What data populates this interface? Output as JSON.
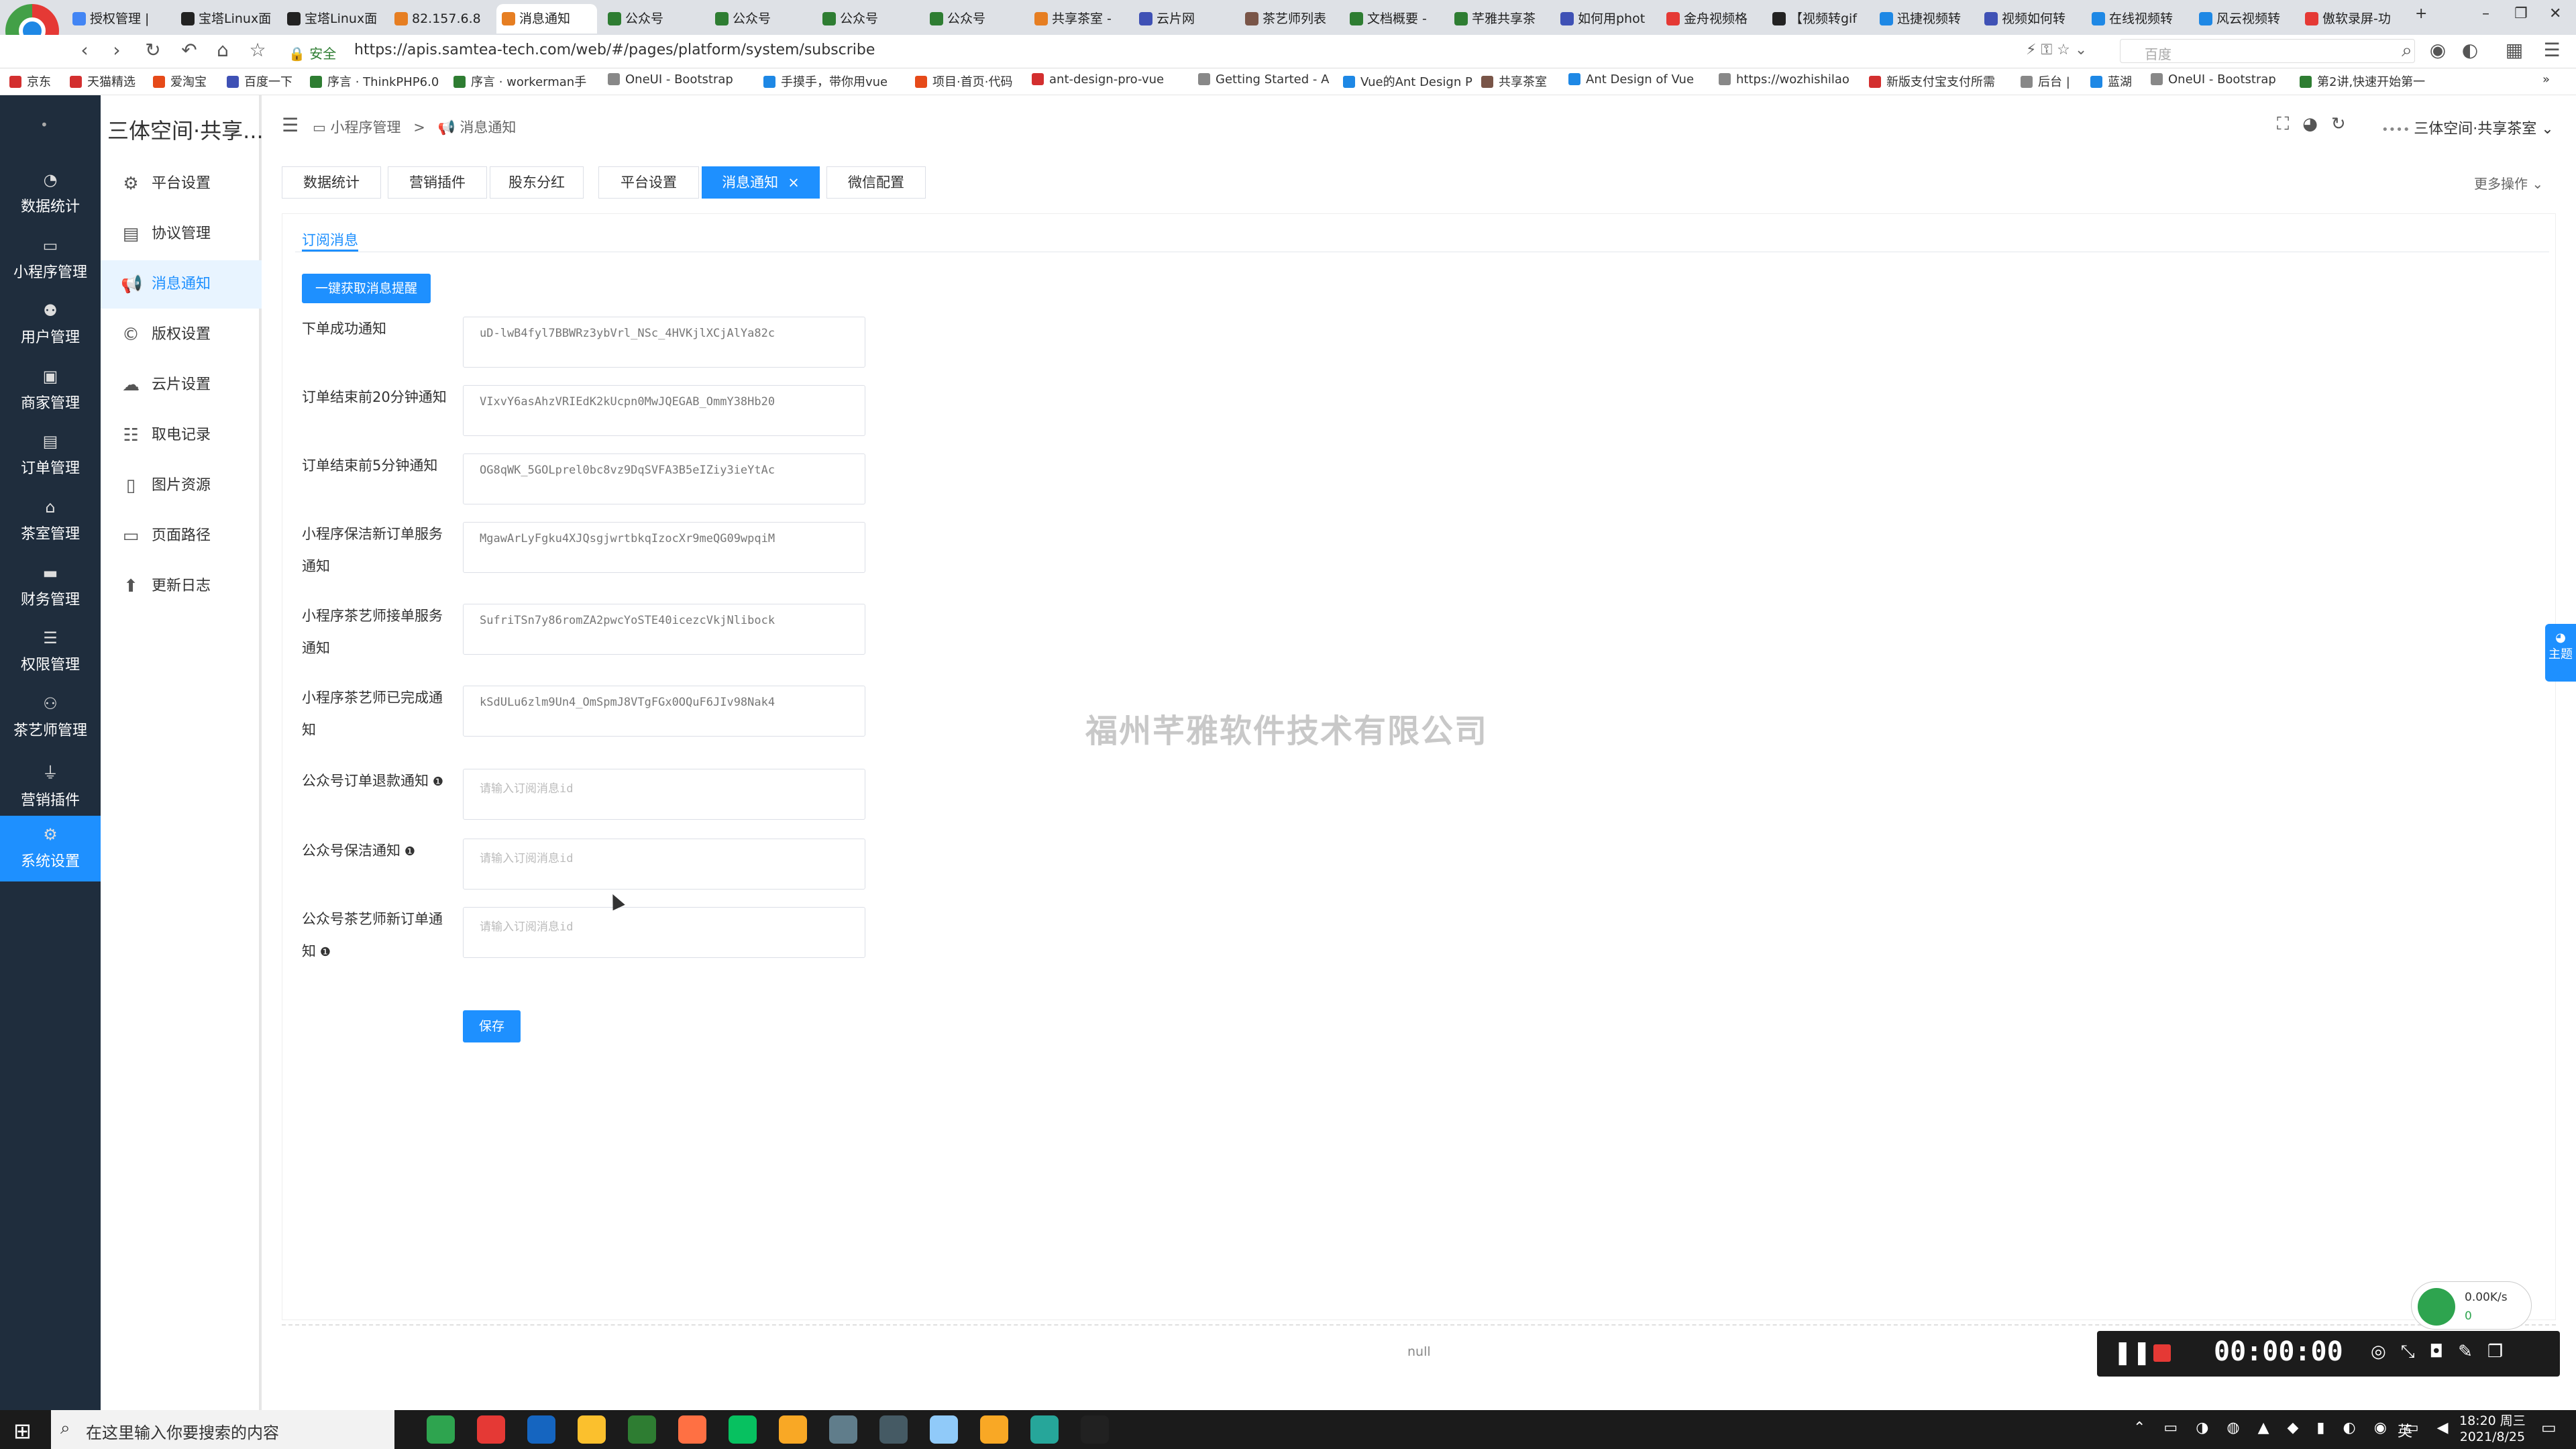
{
  "browser": {
    "tabs": [
      {
        "label": "授权管理 | ",
        "color": "#4285f4"
      },
      {
        "label": "宝塔Linux面",
        "color": "#222222"
      },
      {
        "label": "宝塔Linux面",
        "color": "#222222"
      },
      {
        "label": "82.157.6.8 ",
        "color": "#e67e22"
      },
      {
        "label": "消息通知",
        "color": "#e67e22"
      },
      {
        "label": "公众号",
        "color": "#2e7d32"
      },
      {
        "label": "公众号",
        "color": "#2e7d32"
      },
      {
        "label": "公众号",
        "color": "#2e7d32"
      },
      {
        "label": "公众号",
        "color": "#2e7d32"
      },
      {
        "label": "共享茶室 - ",
        "color": "#e67e22"
      },
      {
        "label": "云片网",
        "color": "#3f51b5"
      },
      {
        "label": "茶艺师列表",
        "color": "#795548"
      },
      {
        "label": "文档概要 - ",
        "color": "#2e7d32"
      },
      {
        "label": "芊雅共享茶",
        "color": "#2e7d32"
      },
      {
        "label": "如何用phot",
        "color": "#3f51b5"
      },
      {
        "label": "金舟视频格",
        "color": "#e53935"
      },
      {
        "label": "【视频转gif",
        "color": "#222222"
      },
      {
        "label": "迅捷视频转",
        "color": "#1e88e5"
      },
      {
        "label": "视频如何转",
        "color": "#3f51b5"
      },
      {
        "label": "在线视频转",
        "color": "#1e88e5"
      },
      {
        "label": "风云视频转",
        "color": "#1e88e5"
      },
      {
        "label": "傲软录屏-功",
        "color": "#e53935"
      }
    ],
    "secure_label": "安全",
    "url": "https://apis.samtea-tech.com/web/#/pages/platform/system/subscribe",
    "search_placeholder": "百度",
    "bookmarks": [
      "京东",
      "天猫精选",
      "爱淘宝",
      "百度一下",
      "序言 · ThinkPHP6.0",
      "序言 · workerman手",
      "OneUI - Bootstrap",
      "手摸手，带你用vue",
      "项目·首页·代码",
      "ant-design-pro-vue",
      "Getting Started - A",
      "Vue的Ant Design P",
      "共享茶室",
      "Ant Design of Vue",
      "https://wozhishilao",
      "新版支付宝支付所需",
      "后台 |",
      "蓝湖",
      "OneUI - Bootstrap",
      "第2讲,快速开始第一"
    ]
  },
  "app": {
    "brand": "三体空间·共享...",
    "sidebar": [
      {
        "label": "数据统计",
        "icon": "dashboard-icon",
        "glyph": "◔"
      },
      {
        "label": "小程序管理",
        "icon": "monitor-icon",
        "glyph": "▭"
      },
      {
        "label": "用户管理",
        "icon": "users-icon",
        "glyph": "⚉"
      },
      {
        "label": "商家管理",
        "icon": "store-icon",
        "glyph": "▣"
      },
      {
        "label": "订单管理",
        "icon": "clipboard-icon",
        "glyph": "▤"
      },
      {
        "label": "茶室管理",
        "icon": "home-icon",
        "glyph": "⌂"
      },
      {
        "label": "财务管理",
        "icon": "wallet-icon",
        "glyph": "▬"
      },
      {
        "label": "权限管理",
        "icon": "database-icon",
        "glyph": "☰"
      },
      {
        "label": "茶艺师管理",
        "icon": "user-icon",
        "glyph": "⚇"
      },
      {
        "label": "营销插件",
        "icon": "plug-icon",
        "glyph": "⏚"
      },
      {
        "label": "系统设置",
        "icon": "gear-icon",
        "glyph": "⚙"
      }
    ],
    "submenu": [
      {
        "label": "平台设置",
        "icon": "gear-icon",
        "glyph": "⚙"
      },
      {
        "label": "协议管理",
        "icon": "document-icon",
        "glyph": "▤"
      },
      {
        "label": "消息通知",
        "icon": "megaphone-icon",
        "glyph": "📢"
      },
      {
        "label": "版权设置",
        "icon": "copyright-icon",
        "glyph": "©"
      },
      {
        "label": "云片设置",
        "icon": "cloud-icon",
        "glyph": "☁"
      },
      {
        "label": "取电记录",
        "icon": "list-icon",
        "glyph": "☷"
      },
      {
        "label": "图片资源",
        "icon": "file-icon",
        "glyph": "▯"
      },
      {
        "label": "页面路径",
        "icon": "monitor-icon",
        "glyph": "▭"
      },
      {
        "label": "更新日志",
        "icon": "arrow-up-circle-icon",
        "glyph": "⬆"
      }
    ],
    "breadcrumb": {
      "parent": "小程序管理",
      "separator": ">",
      "current": "消息通知"
    },
    "user_name": "三体空间·共享茶室",
    "tabs": [
      "数据统计",
      "营销插件",
      "股东分红",
      "平台设置",
      "消息通知",
      "微信配置"
    ],
    "active_tab_close": "×",
    "more_ops": "更多操作",
    "content": {
      "sub_tab": "订阅消息",
      "fetch_button": "一键获取消息提醒",
      "fields": [
        {
          "label": "下单成功通知",
          "value": "uD-lwB4fyl7BBWRz3ybVrl_NSc_4HVKjlXCjAlYa82c",
          "placeholder": "请输入订阅消息id",
          "info": false
        },
        {
          "label": "订单结束前20分钟通知",
          "value": "VIxvY6asAhzVRIEdK2kUcpn0MwJQEGAB_OmmY38Hb20",
          "placeholder": "请输入订阅消息id",
          "info": false
        },
        {
          "label": "订单结束前5分钟通知",
          "value": "OG8qWK_5GOLprel0bc8vz9DqSVFA3B5eIZiy3ieYtAc",
          "placeholder": "请输入订阅消息id",
          "info": false
        },
        {
          "label": "小程序保洁新订单服务通知",
          "value": "MgawArLyFgku4XJQsgjwrtbkqIzocXr9meQG09wpqiM",
          "placeholder": "请输入订阅消息id",
          "info": false
        },
        {
          "label": "小程序茶艺师接单服务通知",
          "value": "SufriTSn7y86romZA2pwcYoSTE40icezcVkjNlibock",
          "placeholder": "请输入订阅消息id",
          "info": false
        },
        {
          "label": "小程序茶艺师已完成通知",
          "value": "kSdULu6zlm9Un4_OmSpmJ8VTgFGx0OQuF6JIv98Nak4",
          "placeholder": "请输入订阅消息id",
          "info": false
        },
        {
          "label": "公众号订单退款通知",
          "value": "",
          "placeholder": "请输入订阅消息id",
          "info": true
        },
        {
          "label": "公众号保洁通知",
          "value": "",
          "placeholder": "请输入订阅消息id",
          "info": true
        },
        {
          "label": "公众号茶艺师新订单通知",
          "value": "",
          "placeholder": "请输入订阅消息id",
          "info": true
        }
      ],
      "save_button": "保存"
    },
    "watermark": "福州芊雅软件技术有限公司",
    "footer_text": "null",
    "theme_button": "主题"
  },
  "recorder": {
    "time": "00:00:00",
    "net_speed": "0.00K/s",
    "net_count": "0"
  },
  "taskbar": {
    "search_placeholder": "在这里输入你要搜索的内容",
    "ime": "英",
    "time": "18:20 周三",
    "date": "2021/8/25",
    "apps": [
      "#2ea44f",
      "#e53935",
      "#1565c0",
      "#fbc02d",
      "#2e7d32",
      "#ff7043",
      "#07c160",
      "#f9a825",
      "#607d8b",
      "#455a64",
      "#90caf9",
      "#f9a825",
      "#26a69a",
      "#212121"
    ]
  }
}
